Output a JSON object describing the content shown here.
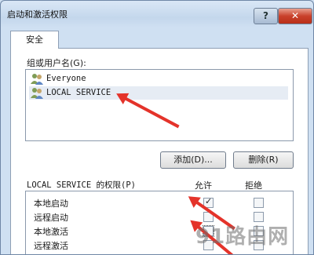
{
  "window": {
    "title": "启动和激活权限",
    "help_label": "?",
    "close_label": "✕"
  },
  "tabs": [
    {
      "label": "安全"
    }
  ],
  "users": {
    "label": "组或用户名(G):",
    "items": [
      {
        "name": "Everyone",
        "selected": false
      },
      {
        "name": "LOCAL SERVICE",
        "selected": true
      }
    ]
  },
  "buttons": {
    "add": "添加(D)...",
    "remove": "删除(R)"
  },
  "permissions": {
    "label": "LOCAL SERVICE 的权限(P)",
    "col_allow": "允许",
    "col_deny": "拒绝",
    "rows": [
      {
        "name": "本地启动",
        "allow": true,
        "deny": false
      },
      {
        "name": "远程启动",
        "allow": false,
        "deny": false
      },
      {
        "name": "本地激活",
        "allow": false,
        "deny": false
      },
      {
        "name": "远程激活",
        "allow": false,
        "deny": false
      }
    ]
  },
  "watermark": "91路由网",
  "colors": {
    "arrow": "#e4332a",
    "title_bar": "#c4d7ec"
  }
}
